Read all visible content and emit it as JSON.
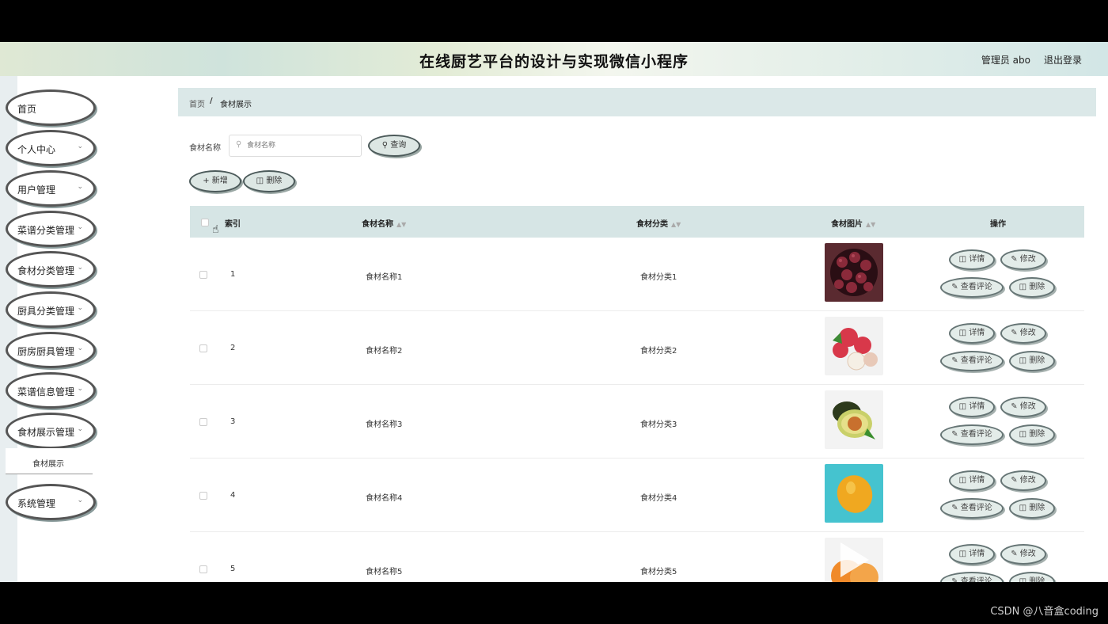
{
  "header": {
    "title": "在线厨艺平台的设计与实现微信小程序",
    "user": "管理员 abo",
    "logout": "退出登录"
  },
  "sidebar": {
    "items": [
      {
        "label": "首页",
        "has_children": false
      },
      {
        "label": "个人中心",
        "has_children": true
      },
      {
        "label": "用户管理",
        "has_children": true
      },
      {
        "label": "菜谱分类管理",
        "has_children": true
      },
      {
        "label": "食材分类管理",
        "has_children": true
      },
      {
        "label": "厨具分类管理",
        "has_children": true
      },
      {
        "label": "厨房厨具管理",
        "has_children": true
      },
      {
        "label": "菜谱信息管理",
        "has_children": true
      },
      {
        "label": "食材展示管理",
        "has_children": true
      },
      {
        "label": "系统管理",
        "has_children": true
      }
    ],
    "active_sub": "食材展示"
  },
  "breadcrumb": {
    "home": "首页",
    "sep": "/",
    "current": "食材展示"
  },
  "search": {
    "label": "食材名称",
    "placeholder": "食材名称",
    "value": "",
    "query_button": "查询"
  },
  "toolbar": {
    "add": "新增",
    "delete": "删除"
  },
  "table": {
    "columns": {
      "index": "索引",
      "name": "食材名称",
      "category": "食材分类",
      "image": "食材图片",
      "actions": "操作"
    },
    "actions": {
      "detail": "详情",
      "edit": "修改",
      "comments": "查看评论",
      "delete": "删除"
    },
    "rows": [
      {
        "index": "1",
        "name": "食材名称1",
        "category": "食材分类1",
        "image": "berries-image"
      },
      {
        "index": "2",
        "name": "食材名称2",
        "category": "食材分类2",
        "image": "lychee-image"
      },
      {
        "index": "3",
        "name": "食材名称3",
        "category": "食材分类3",
        "image": "avocado-image"
      },
      {
        "index": "4",
        "name": "食材名称4",
        "category": "食材分类4",
        "image": "lemon-image"
      },
      {
        "index": "5",
        "name": "食材名称5",
        "category": "食材分类5",
        "image": "apricot-image"
      }
    ]
  },
  "watermark": "CSDN @八音盒coding",
  "colors": {
    "accent": "#dbe8e8",
    "table_header": "#d6e5e5"
  }
}
